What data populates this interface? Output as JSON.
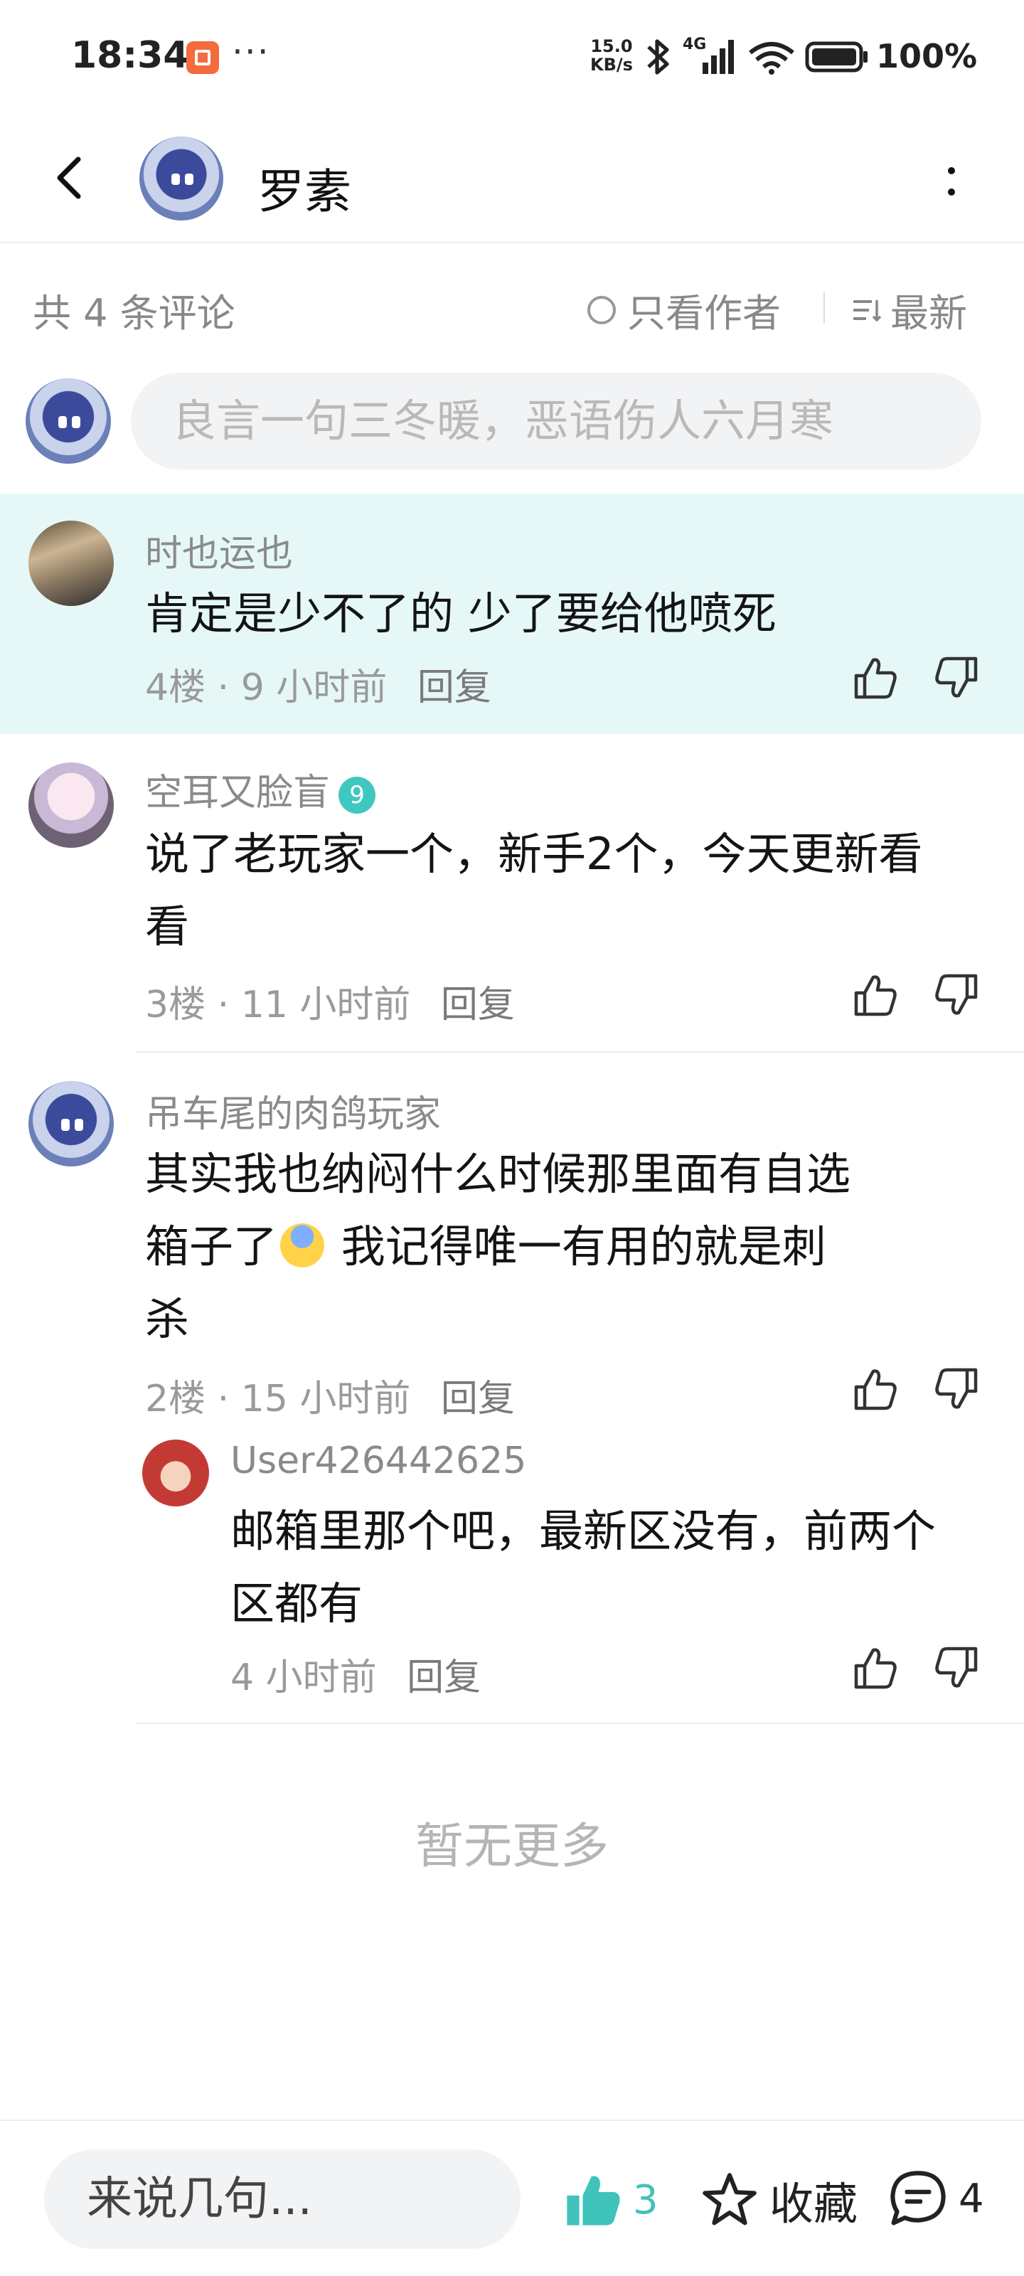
{
  "status_bar": {
    "time": "18:34",
    "more": "···",
    "net_speed_value": "15.0",
    "net_speed_unit": "KB/s",
    "network_type": "4G",
    "battery": "100%"
  },
  "header": {
    "title": "罗素"
  },
  "filters": {
    "count_label": "共 4 条评论",
    "author_only_label": "只看作者",
    "sort_label": "最新"
  },
  "comment_input": {
    "placeholder": "良言一句三冬暖，恶语伤人六月寒"
  },
  "comments": [
    {
      "user": "时也运也",
      "text": "肯定是少不了的 少了要给他喷死",
      "floor": "4楼",
      "time": "9 小时前",
      "reply": "回复",
      "highlighted": true
    },
    {
      "user": "空耳又脸盲",
      "level": "9",
      "text": "说了老玩家一个，新手2个，今天更新看看",
      "floor": "3楼",
      "time": "11 小时前",
      "reply": "回复"
    },
    {
      "user": "吊车尾的肉鸽玩家",
      "text_line1": "其实我也纳闷什么时候那里面有自选",
      "text_line2a": "箱子了",
      "text_line2b": " 我记得唯一有用的就是刺",
      "text_line3": "杀",
      "floor": "2楼",
      "time": "15 小时前",
      "reply": "回复",
      "replies": [
        {
          "user": "User426442625",
          "text": "邮箱里那个吧，最新区没有，前两个区都有",
          "time": "4 小时前",
          "reply": "回复"
        }
      ]
    }
  ],
  "no_more": "暂无更多",
  "bottom_bar": {
    "input_label": "来说几句...",
    "like_count": "3",
    "favorite_label": "收藏",
    "comment_count": "4"
  },
  "colors": {
    "accent": "#3fc3bb",
    "highlight_bg": "#e6f7f7"
  },
  "icons": [
    "back-arrow-icon",
    "more-vert-icon",
    "thumb-up-icon",
    "thumb-down-icon",
    "star-icon",
    "comment-bubble-icon",
    "sort-icon"
  ]
}
